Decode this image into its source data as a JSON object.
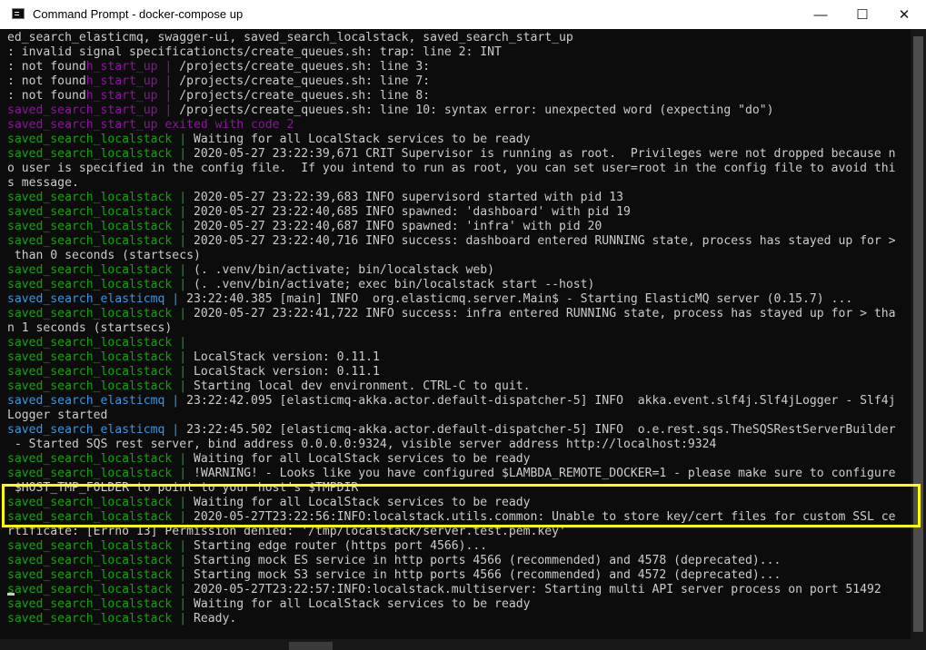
{
  "window": {
    "title": "Command Prompt - docker-compose  up",
    "minimize": "—",
    "maximize": "☐",
    "close": "✕"
  },
  "console": {
    "lines": [
      [
        [
          "w",
          "ed_search_elasticmq, swagger-ui, saved_search_localstack, saved_search_start_up"
        ]
      ],
      [
        [
          "w",
          ": invalid signal specificationcts/create_queues.sh: trap: line 2: INT"
        ]
      ],
      [
        [
          "w",
          ": not found"
        ],
        [
          "m",
          "h_start_up | "
        ],
        [
          "w",
          "/projects/create_queues.sh: line 3:"
        ]
      ],
      [
        [
          "w",
          ": not found"
        ],
        [
          "m",
          "h_start_up | "
        ],
        [
          "w",
          "/projects/create_queues.sh: line 7:"
        ]
      ],
      [
        [
          "w",
          ": not found"
        ],
        [
          "m",
          "h_start_up | "
        ],
        [
          "w",
          "/projects/create_queues.sh: line 8:"
        ]
      ],
      [
        [
          "m",
          "saved_search_start_up | "
        ],
        [
          "w",
          "/projects/create_queues.sh: line 10: syntax error: unexpected word (expecting \"do\")"
        ]
      ],
      [
        [
          "m",
          "saved_search_start_up exited with code 2"
        ]
      ],
      [
        [
          "g",
          "saved_search_localstack | "
        ],
        [
          "w",
          "Waiting for all LocalStack services to be ready"
        ]
      ],
      [
        [
          "g",
          "saved_search_localstack | "
        ],
        [
          "w",
          "2020-05-27 23:22:39,671 CRIT Supervisor is running as root.  Privileges were not dropped because n"
        ]
      ],
      [
        [
          "w",
          "o user is specified in the config file.  If you intend to run as root, you can set user=root in the config file to avoid thi"
        ]
      ],
      [
        [
          "w",
          "s message."
        ]
      ],
      [
        [
          "g",
          "saved_search_localstack | "
        ],
        [
          "w",
          "2020-05-27 23:22:39,683 INFO supervisord started with pid 13"
        ]
      ],
      [
        [
          "g",
          "saved_search_localstack | "
        ],
        [
          "w",
          "2020-05-27 23:22:40,685 INFO spawned: 'dashboard' with pid 19"
        ]
      ],
      [
        [
          "g",
          "saved_search_localstack | "
        ],
        [
          "w",
          "2020-05-27 23:22:40,687 INFO spawned: 'infra' with pid 20"
        ]
      ],
      [
        [
          "g",
          "saved_search_localstack | "
        ],
        [
          "w",
          "2020-05-27 23:22:40,716 INFO success: dashboard entered RUNNING state, process has stayed up for >"
        ]
      ],
      [
        [
          "w",
          " than 0 seconds (startsecs)"
        ]
      ],
      [
        [
          "g",
          "saved_search_localstack | "
        ],
        [
          "w",
          "(. .venv/bin/activate; bin/localstack web)"
        ]
      ],
      [
        [
          "g",
          "saved_search_localstack | "
        ],
        [
          "w",
          "(. .venv/bin/activate; exec bin/localstack start --host)"
        ]
      ],
      [
        [
          "b",
          "saved_search_elasticmq | "
        ],
        [
          "w",
          "23:22:40.385 [main] INFO  org.elasticmq.server.Main$ - Starting ElasticMQ server (0.15.7) ..."
        ]
      ],
      [
        [
          "g",
          "saved_search_localstack | "
        ],
        [
          "w",
          "2020-05-27 23:22:41,722 INFO success: infra entered RUNNING state, process has stayed up for > tha"
        ]
      ],
      [
        [
          "w",
          "n 1 seconds (startsecs)"
        ]
      ],
      [
        [
          "g",
          "saved_search_localstack | "
        ]
      ],
      [
        [
          "g",
          "saved_search_localstack | "
        ],
        [
          "w",
          "LocalStack version: 0.11.1"
        ]
      ],
      [
        [
          "g",
          "saved_search_localstack | "
        ],
        [
          "w",
          "LocalStack version: 0.11.1"
        ]
      ],
      [
        [
          "g",
          "saved_search_localstack | "
        ],
        [
          "w",
          "Starting local dev environment. CTRL-C to quit."
        ]
      ],
      [
        [
          "b",
          "saved_search_elasticmq | "
        ],
        [
          "w",
          "23:22:42.095 [elasticmq-akka.actor.default-dispatcher-5] INFO  akka.event.slf4j.Slf4jLogger - Slf4j"
        ]
      ],
      [
        [
          "w",
          "Logger started"
        ]
      ],
      [
        [
          "b",
          "saved_search_elasticmq | "
        ],
        [
          "w",
          "23:22:45.502 [elasticmq-akka.actor.default-dispatcher-5] INFO  o.e.rest.sqs.TheSQSRestServerBuilder"
        ]
      ],
      [
        [
          "w",
          " - Started SQS rest server, bind address 0.0.0.0:9324, visible server address http://localhost:9324"
        ]
      ],
      [
        [
          "g",
          "saved_search_localstack | "
        ],
        [
          "w",
          "Waiting for all LocalStack services to be ready"
        ]
      ],
      [
        [
          "g",
          "saved_search_localstack | "
        ],
        [
          "w",
          "!WARNING! - Looks like you have configured $LAMBDA_REMOTE_DOCKER=1 - please make sure to configure"
        ]
      ],
      [
        [
          "w",
          " $HOST_TMP_FOLDER to point to your host's $TMPDIR"
        ]
      ],
      [
        [
          "g",
          "saved_search_localstack | "
        ],
        [
          "w",
          "Waiting for all LocalStack services to be ready"
        ]
      ],
      [
        [
          "g",
          "saved_search_localstack | "
        ],
        [
          "w",
          "2020-05-27T23:22:56:INFO:localstack.utils.common: Unable to store key/cert files for custom SSL ce"
        ]
      ],
      [
        [
          "w",
          "rtificate: [Errno 13] Permission denied: '/tmp/localstack/server.test.pem.key'"
        ]
      ],
      [
        [
          "g",
          "saved_search_localstack | "
        ],
        [
          "w",
          "Starting edge router (https port 4566)..."
        ]
      ],
      [
        [
          "g",
          "saved_search_localstack | "
        ],
        [
          "w",
          "Starting mock ES service in http ports 4566 (recommended) and 4578 (deprecated)..."
        ]
      ],
      [
        [
          "g",
          "saved_search_localstack | "
        ],
        [
          "w",
          "Starting mock S3 service in http ports 4566 (recommended) and 4572 (deprecated)..."
        ]
      ],
      [
        [
          "g",
          "saved_search_localstack | "
        ],
        [
          "w",
          "2020-05-27T23:22:57:INFO:localstack.multiserver: Starting multi API server process on port 51492"
        ]
      ],
      [
        [
          "g",
          "saved_search_localstack | "
        ],
        [
          "w",
          "Waiting for all LocalStack services to be ready"
        ]
      ],
      [
        [
          "g",
          "saved_search_localstack | "
        ],
        [
          "w",
          "Ready."
        ]
      ]
    ]
  },
  "colors": {
    "background": "#0c0c0c",
    "text": "#cccccc",
    "green": "#13a10e",
    "blue": "#3a96dd",
    "magenta": "#881798",
    "highlight_box": "#ffff00"
  }
}
